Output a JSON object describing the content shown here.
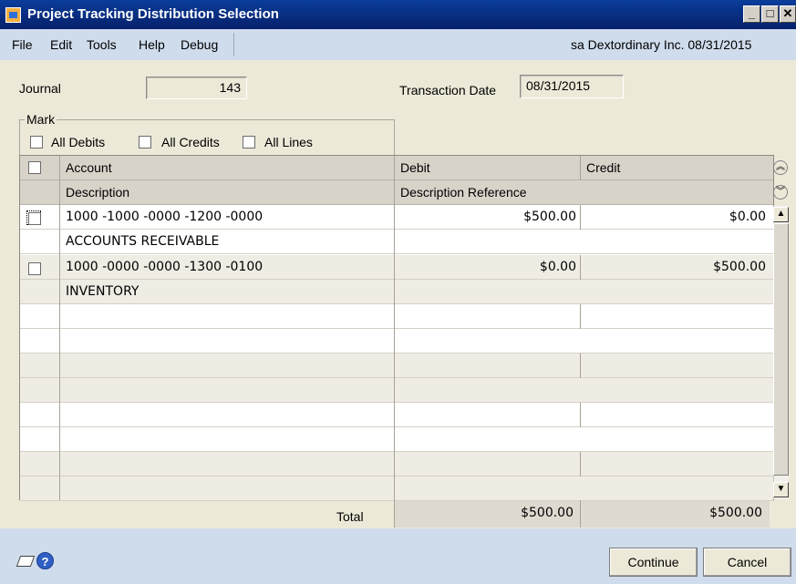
{
  "window": {
    "title": "Project Tracking Distribution Selection"
  },
  "menu": {
    "items": [
      "File",
      "Edit",
      "Tools",
      "Help",
      "Debug"
    ],
    "user_info": "sa  Dextordinary Inc.  08/31/2015"
  },
  "header": {
    "journal_label": "Journal",
    "journal_value": "143",
    "date_label": "Transaction Date",
    "date_value": "08/31/2015"
  },
  "mark": {
    "title": "Mark",
    "all_debits": "All Debits",
    "all_credits": "All Credits",
    "all_lines": "All Lines"
  },
  "grid": {
    "headers": {
      "account": "Account",
      "description": "Description",
      "debit": "Debit",
      "credit": "Credit",
      "description_reference": "Description Reference"
    },
    "rows": [
      {
        "account": "1000 -1000 -0000 -1200 -0000",
        "description": "ACCOUNTS RECEIVABLE",
        "debit": "$500.00",
        "credit": "$0.00"
      },
      {
        "account": "1000 -0000 -0000 -1300 -0100",
        "description": "INVENTORY",
        "debit": "$0.00",
        "credit": "$500.00"
      }
    ],
    "total_label": "Total",
    "total_debit": "$500.00",
    "total_credit": "$500.00"
  },
  "buttons": {
    "continue": "Continue",
    "cancel": "Cancel"
  }
}
